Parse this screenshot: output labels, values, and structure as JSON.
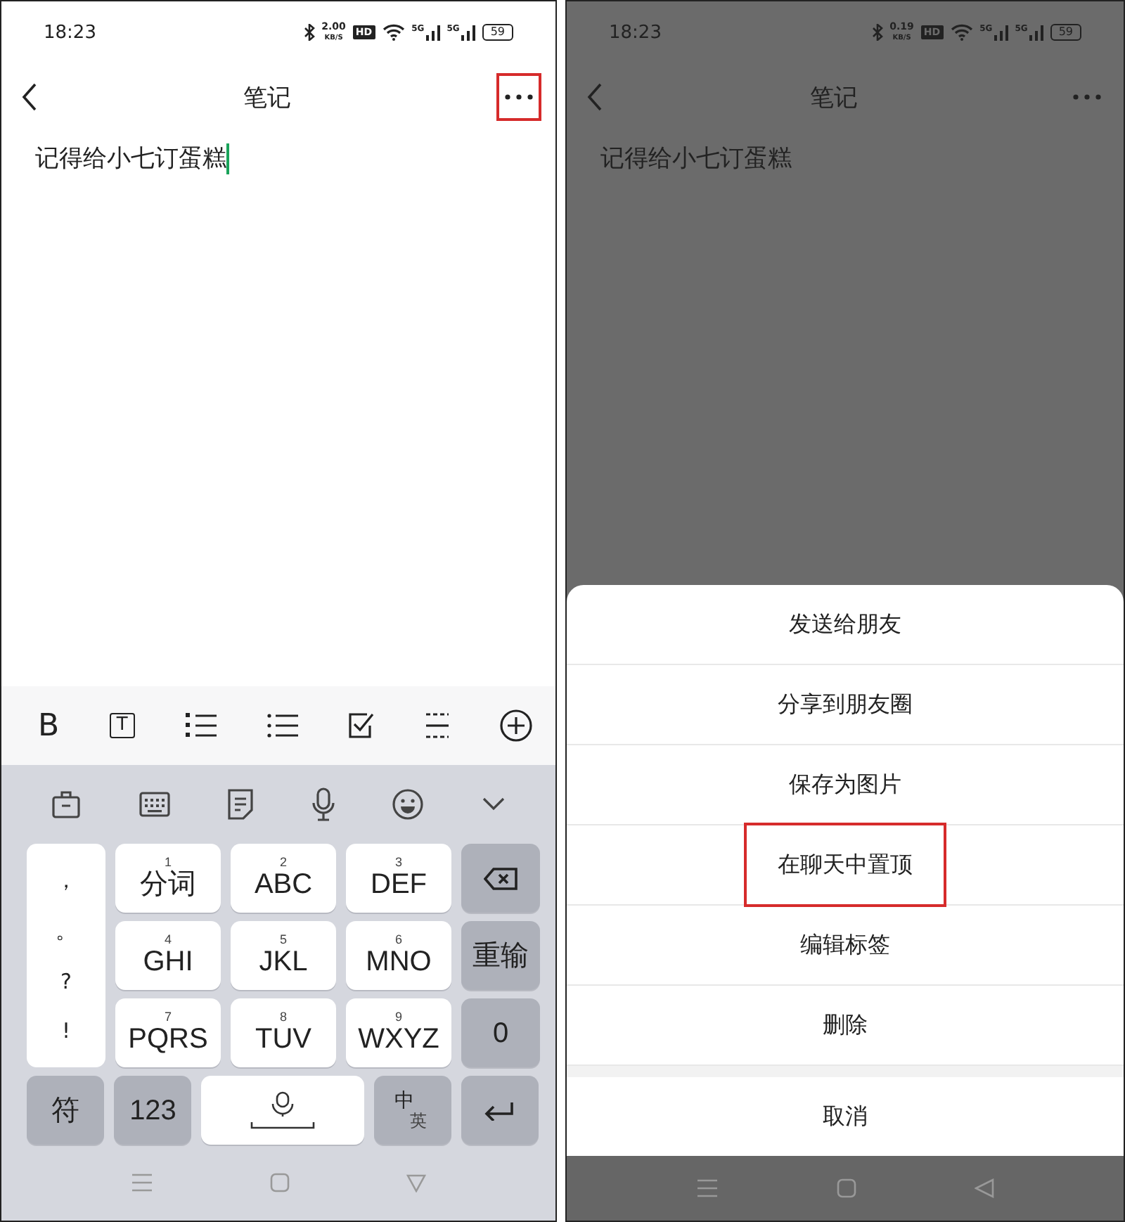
{
  "left_screen": {
    "status_bar": {
      "time": "18:23",
      "speed": "2.00",
      "speed_unit": "KB/S",
      "hd": "HD",
      "network": [
        "5G",
        "5G"
      ],
      "battery": "59"
    },
    "header": {
      "title": "笔记",
      "more_highlighted": true
    },
    "note": {
      "text": "记得给小七订蛋糕",
      "cursor": true
    },
    "format_toolbar": {
      "bold": "B",
      "text_style": "T"
    },
    "keyboard": {
      "punctuation": [
        "，",
        "。",
        "?",
        "!"
      ],
      "keys": [
        {
          "digit": "1",
          "label": "分词"
        },
        {
          "digit": "2",
          "label": "ABC"
        },
        {
          "digit": "3",
          "label": "DEF"
        },
        {
          "digit": "4",
          "label": "GHI"
        },
        {
          "digit": "5",
          "label": "JKL"
        },
        {
          "digit": "6",
          "label": "MNO"
        },
        {
          "digit": "7",
          "label": "PQRS"
        },
        {
          "digit": "8",
          "label": "TUV"
        },
        {
          "digit": "9",
          "label": "WXYZ"
        }
      ],
      "side_keys": [
        {
          "kind": "delete"
        },
        {
          "kind": "text",
          "label": "重输"
        },
        {
          "kind": "text",
          "label": "0"
        }
      ],
      "symbols": "符",
      "numbers": "123",
      "lang_main": "中",
      "lang_alt": "英"
    }
  },
  "right_screen": {
    "status_bar": {
      "time": "18:23",
      "speed": "0.19",
      "speed_unit": "KB/S",
      "hd": "HD",
      "network": [
        "5G",
        "5G"
      ],
      "battery": "59"
    },
    "header": {
      "title": "笔记"
    },
    "note": {
      "text": "记得给小七订蛋糕"
    },
    "action_sheet": {
      "items": [
        {
          "label": "发送给朋友",
          "highlighted": false
        },
        {
          "label": "分享到朋友圈",
          "highlighted": false
        },
        {
          "label": "保存为图片",
          "highlighted": false
        },
        {
          "label": "在聊天中置顶",
          "highlighted": true
        },
        {
          "label": "编辑标签",
          "highlighted": false
        },
        {
          "label": "删除",
          "highlighted": false
        }
      ],
      "cancel": "取消"
    }
  }
}
